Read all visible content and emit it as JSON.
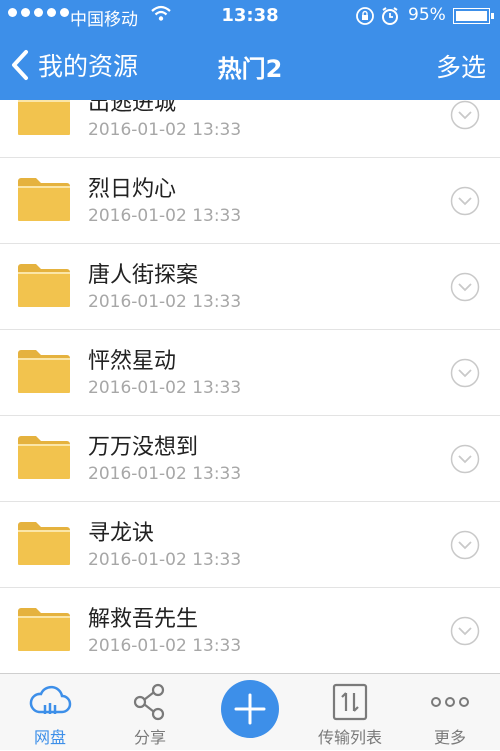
{
  "status_bar": {
    "carrier": "中国移动",
    "time": "13:38",
    "battery_percent": "95%"
  },
  "nav": {
    "back_label": "我的资源",
    "title": "热门2",
    "multi_select": "多选"
  },
  "files": [
    {
      "name": "出逃进城",
      "date": "2016-01-02 13:33"
    },
    {
      "name": "烈日灼心",
      "date": "2016-01-02 13:33"
    },
    {
      "name": "唐人街探案",
      "date": "2016-01-02 13:33"
    },
    {
      "name": "怦然星动",
      "date": "2016-01-02 13:33"
    },
    {
      "name": "万万没想到",
      "date": "2016-01-02 13:33"
    },
    {
      "name": "寻龙诀",
      "date": "2016-01-02 13:33"
    },
    {
      "name": "解救吾先生",
      "date": "2016-01-02 13:33"
    }
  ],
  "tabbar": {
    "tabs": [
      {
        "label": "网盘",
        "icon": "cloud-icon",
        "active": true
      },
      {
        "label": "分享",
        "icon": "share-icon",
        "active": false
      },
      {
        "label": "",
        "icon": "plus-icon",
        "active": false
      },
      {
        "label": "传输列表",
        "icon": "transfer-icon",
        "active": false
      },
      {
        "label": "更多",
        "icon": "more-icon",
        "active": false
      }
    ]
  },
  "colors": {
    "accent": "#3d8fe9",
    "folder": "#f2c34e",
    "date_text": "#a7a7a7"
  }
}
